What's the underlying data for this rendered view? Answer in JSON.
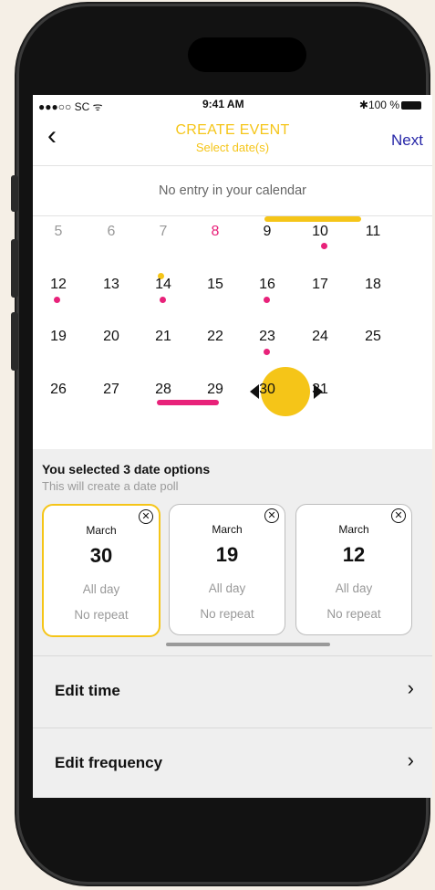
{
  "status_bar": {
    "carrier": "●●●○○ SC ᯤ",
    "time": "9:41 AM",
    "battery": "✱100 %"
  },
  "nav": {
    "back_icon": "‹",
    "title": "CREATE EVENT",
    "subtitle": "Select date(s)",
    "next_label": "Next"
  },
  "banner": "No entry in your calendar",
  "calendar": {
    "rows": [
      [
        "5",
        "6",
        "7",
        "8",
        "9",
        "10",
        "11"
      ],
      [
        "12",
        "13",
        "14",
        "15",
        "16",
        "17",
        "18"
      ],
      [
        "19",
        "20",
        "21",
        "22",
        "23",
        "24",
        "25"
      ],
      [
        "26",
        "27",
        "28",
        "29",
        "30",
        "31",
        ""
      ]
    ],
    "today": "8",
    "selected": "30"
  },
  "selection": {
    "title": "You selected 3 date options",
    "subtitle": "This will create a date poll",
    "cards": [
      {
        "month": "March",
        "day": "30",
        "allday": "All day",
        "repeat": "No repeat"
      },
      {
        "month": "March",
        "day": "19",
        "allday": "All day",
        "repeat": "No repeat"
      },
      {
        "month": "March",
        "day": "12",
        "allday": "All day",
        "repeat": "No repeat"
      }
    ],
    "remove_icon": "✕"
  },
  "actions": [
    {
      "label": "Edit time",
      "chevron": "›"
    },
    {
      "label": "Edit frequency",
      "chevron": "›"
    }
  ],
  "colors": {
    "accent": "#f5c518",
    "pink": "#e8227a",
    "link": "#2727a8"
  }
}
